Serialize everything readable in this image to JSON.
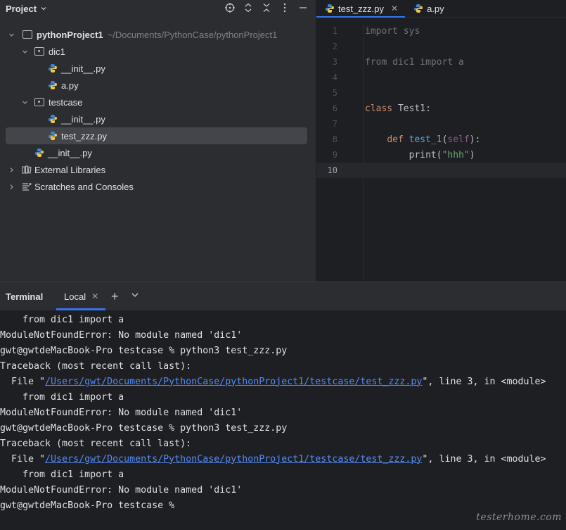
{
  "project": {
    "title": "Project",
    "icons": [
      "crosshair-icon",
      "expand-collapse-icon",
      "collapse-all-icon",
      "more-icon",
      "minimize-icon"
    ],
    "tree": [
      {
        "label": "pythonProject1",
        "path": "~/Documents/PythonCase/pythonProject1",
        "icon": "folder-icon"
      },
      {
        "label": "dic1",
        "icon": "package-icon"
      },
      {
        "label": "__init__.py",
        "icon": "python-icon"
      },
      {
        "label": "a.py",
        "icon": "python-icon"
      },
      {
        "label": "testcase",
        "icon": "package-icon"
      },
      {
        "label": "__init__.py",
        "icon": "python-icon"
      },
      {
        "label": "test_zzz.py",
        "icon": "python-icon",
        "selected": true
      },
      {
        "label": "__init__.py",
        "icon": "python-icon"
      },
      {
        "label": "External Libraries",
        "icon": "library-icon"
      },
      {
        "label": "Scratches and Consoles",
        "icon": "scratches-icon"
      }
    ]
  },
  "editor": {
    "tabs": [
      {
        "label": "test_zzz.py",
        "active": true
      },
      {
        "label": "a.py",
        "active": false
      }
    ],
    "lines": [
      {
        "num": "1",
        "text": "import sys"
      },
      {
        "num": "2",
        "text": ""
      },
      {
        "num": "3",
        "text": "from dic1 import a"
      },
      {
        "num": "4",
        "text": ""
      },
      {
        "num": "5",
        "text": ""
      },
      {
        "num": "6",
        "kw": "class",
        "name": " Test1:"
      },
      {
        "num": "7",
        "text": ""
      },
      {
        "num": "8",
        "indent": "    ",
        "kw": "def",
        "fn": " test_1",
        "p1": "(",
        "self": "self",
        "p2": "):"
      },
      {
        "num": "9",
        "indent": "        ",
        "call": "print(",
        "str": "\"hhh\"",
        "close": ")"
      },
      {
        "num": "10",
        "text": "",
        "current": true
      }
    ]
  },
  "terminal": {
    "title": "Terminal",
    "tab": "Local",
    "lines": [
      {
        "text": "    from dic1 import a"
      },
      {
        "text": "ModuleNotFoundError: No module named 'dic1'"
      },
      {
        "text": "gwt@gwtdeMacBook-Pro testcase % python3 test_zzz.py"
      },
      {
        "text": "Traceback (most recent call last):"
      },
      {
        "pre": "  File \"",
        "link": "/Users/gwt/Documents/PythonCase/pythonProject1/testcase/test_zzz.py",
        "post": "\", line 3, in <module>"
      },
      {
        "text": "    from dic1 import a"
      },
      {
        "text": "ModuleNotFoundError: No module named 'dic1'"
      },
      {
        "text": "gwt@gwtdeMacBook-Pro testcase % python3 test_zzz.py"
      },
      {
        "text": "Traceback (most recent call last):"
      },
      {
        "pre": "  File \"",
        "link": "/Users/gwt/Documents/PythonCase/pythonProject1/testcase/test_zzz.py",
        "post": "\", line 3, in <module>"
      },
      {
        "text": "    from dic1 import a"
      },
      {
        "text": "ModuleNotFoundError: No module named 'dic1'"
      },
      {
        "text": "gwt@gwtdeMacBook-Pro testcase % "
      }
    ],
    "watermark": "testerhome.com"
  }
}
